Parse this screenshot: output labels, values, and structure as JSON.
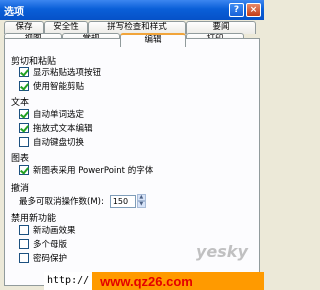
{
  "window": {
    "title": "选项"
  },
  "title_buttons": {
    "help": "?",
    "close": "×"
  },
  "tabs_back": [
    "保存",
    "安全性",
    "拼写检查和样式",
    "要闻"
  ],
  "tabs_front": [
    "视图",
    "常规",
    "编辑",
    "打印"
  ],
  "active_tab": "编辑",
  "sections": {
    "cut_paste": {
      "label": "剪切和粘贴",
      "items": [
        {
          "label": "显示粘贴选项按钮",
          "checked": true
        },
        {
          "label": "使用智能剪贴",
          "checked": true
        }
      ]
    },
    "text": {
      "label": "文本",
      "items": [
        {
          "label": "自动单词选定",
          "checked": true
        },
        {
          "label": "拖放式文本编辑",
          "checked": true
        },
        {
          "label": "自动键盘切换",
          "checked": false
        }
      ]
    },
    "chart": {
      "label": "图表",
      "items": [
        {
          "label": "新图表采用 PowerPoint 的字体",
          "checked": true
        }
      ]
    },
    "undo": {
      "label": "撤消",
      "max_label": "最多可取消操作数(M):",
      "max_value": "150"
    },
    "disable": {
      "label": "禁用新功能",
      "items": [
        {
          "label": "新动画效果",
          "checked": false
        },
        {
          "label": "多个母版",
          "checked": false
        },
        {
          "label": "密码保护",
          "checked": false
        }
      ]
    }
  },
  "watermark": "yesky",
  "url": {
    "prefix": "http://",
    "site": "www.qz26.com"
  }
}
